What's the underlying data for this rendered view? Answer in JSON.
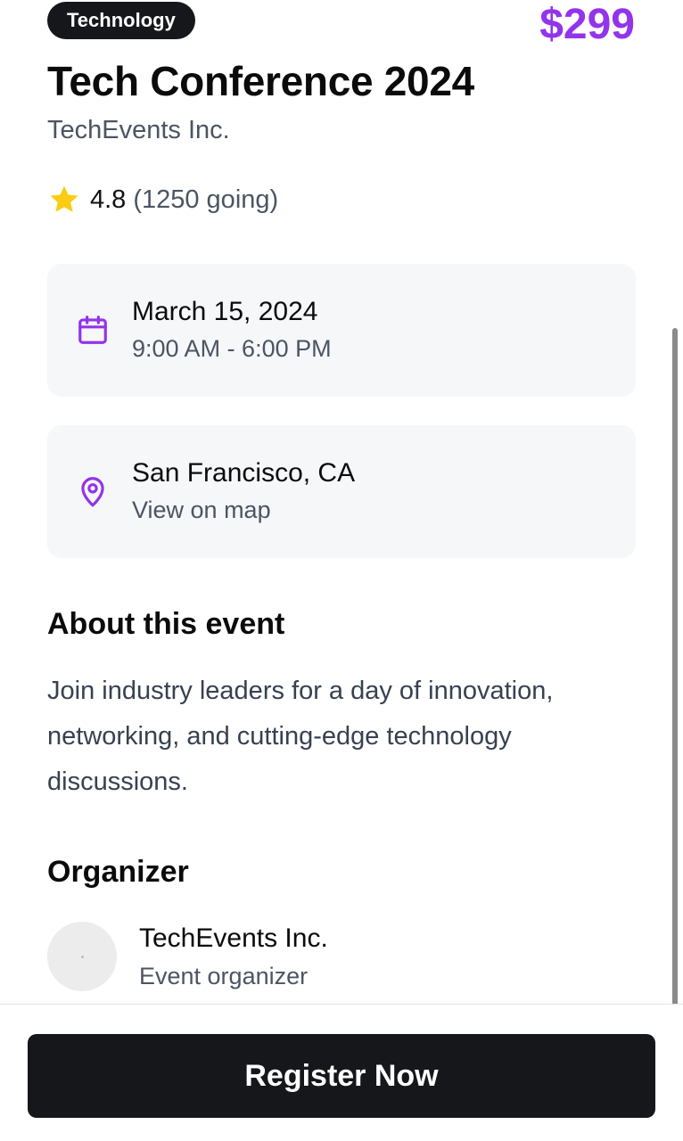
{
  "event": {
    "category": "Technology",
    "price": "$299",
    "title": "Tech Conference 2024",
    "host": "TechEvents Inc.",
    "rating": "4.8",
    "going": "(1250 going)"
  },
  "date_card": {
    "icon": "calendar-icon",
    "date": "March 15, 2024",
    "time": "9:00 AM - 6:00 PM"
  },
  "location_card": {
    "icon": "map-pin-icon",
    "location": "San Francisco, CA",
    "link": "View on map"
  },
  "about": {
    "heading": "About this event",
    "text": "Join industry leaders for a day of innovation, networking, and cutting-edge technology discussions."
  },
  "organizer": {
    "heading": "Organizer",
    "name": "TechEvents Inc.",
    "role": "Event organizer"
  },
  "footer": {
    "button_label": "Register Now"
  },
  "colors": {
    "accent": "#9333ea",
    "star": "#facc15",
    "button": "#16171b",
    "card_bg": "#f6f7f9"
  }
}
